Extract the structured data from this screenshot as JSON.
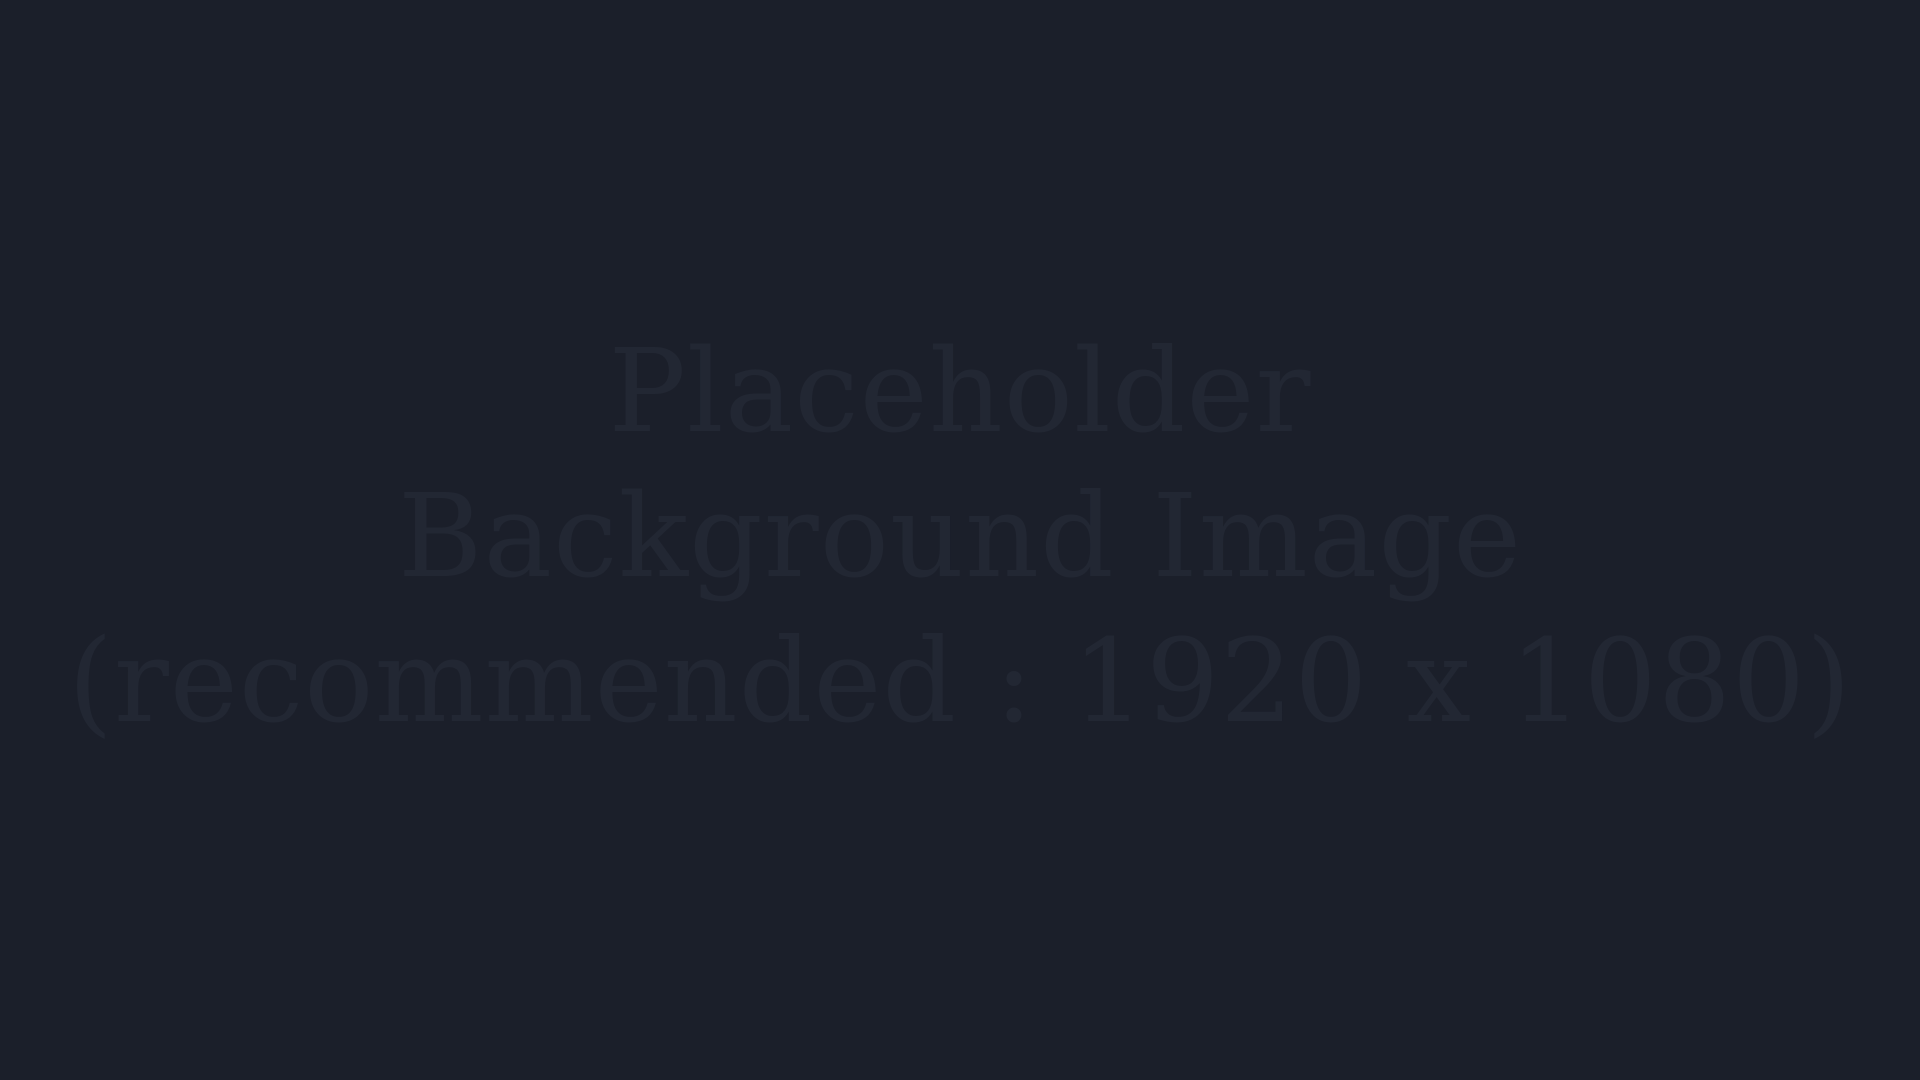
{
  "background": {
    "color": "#1b1f2a",
    "text_color": "#222733",
    "lines": [
      "Placeholder",
      "Background Image",
      "(recommended : 1920 x 1080)"
    ]
  }
}
